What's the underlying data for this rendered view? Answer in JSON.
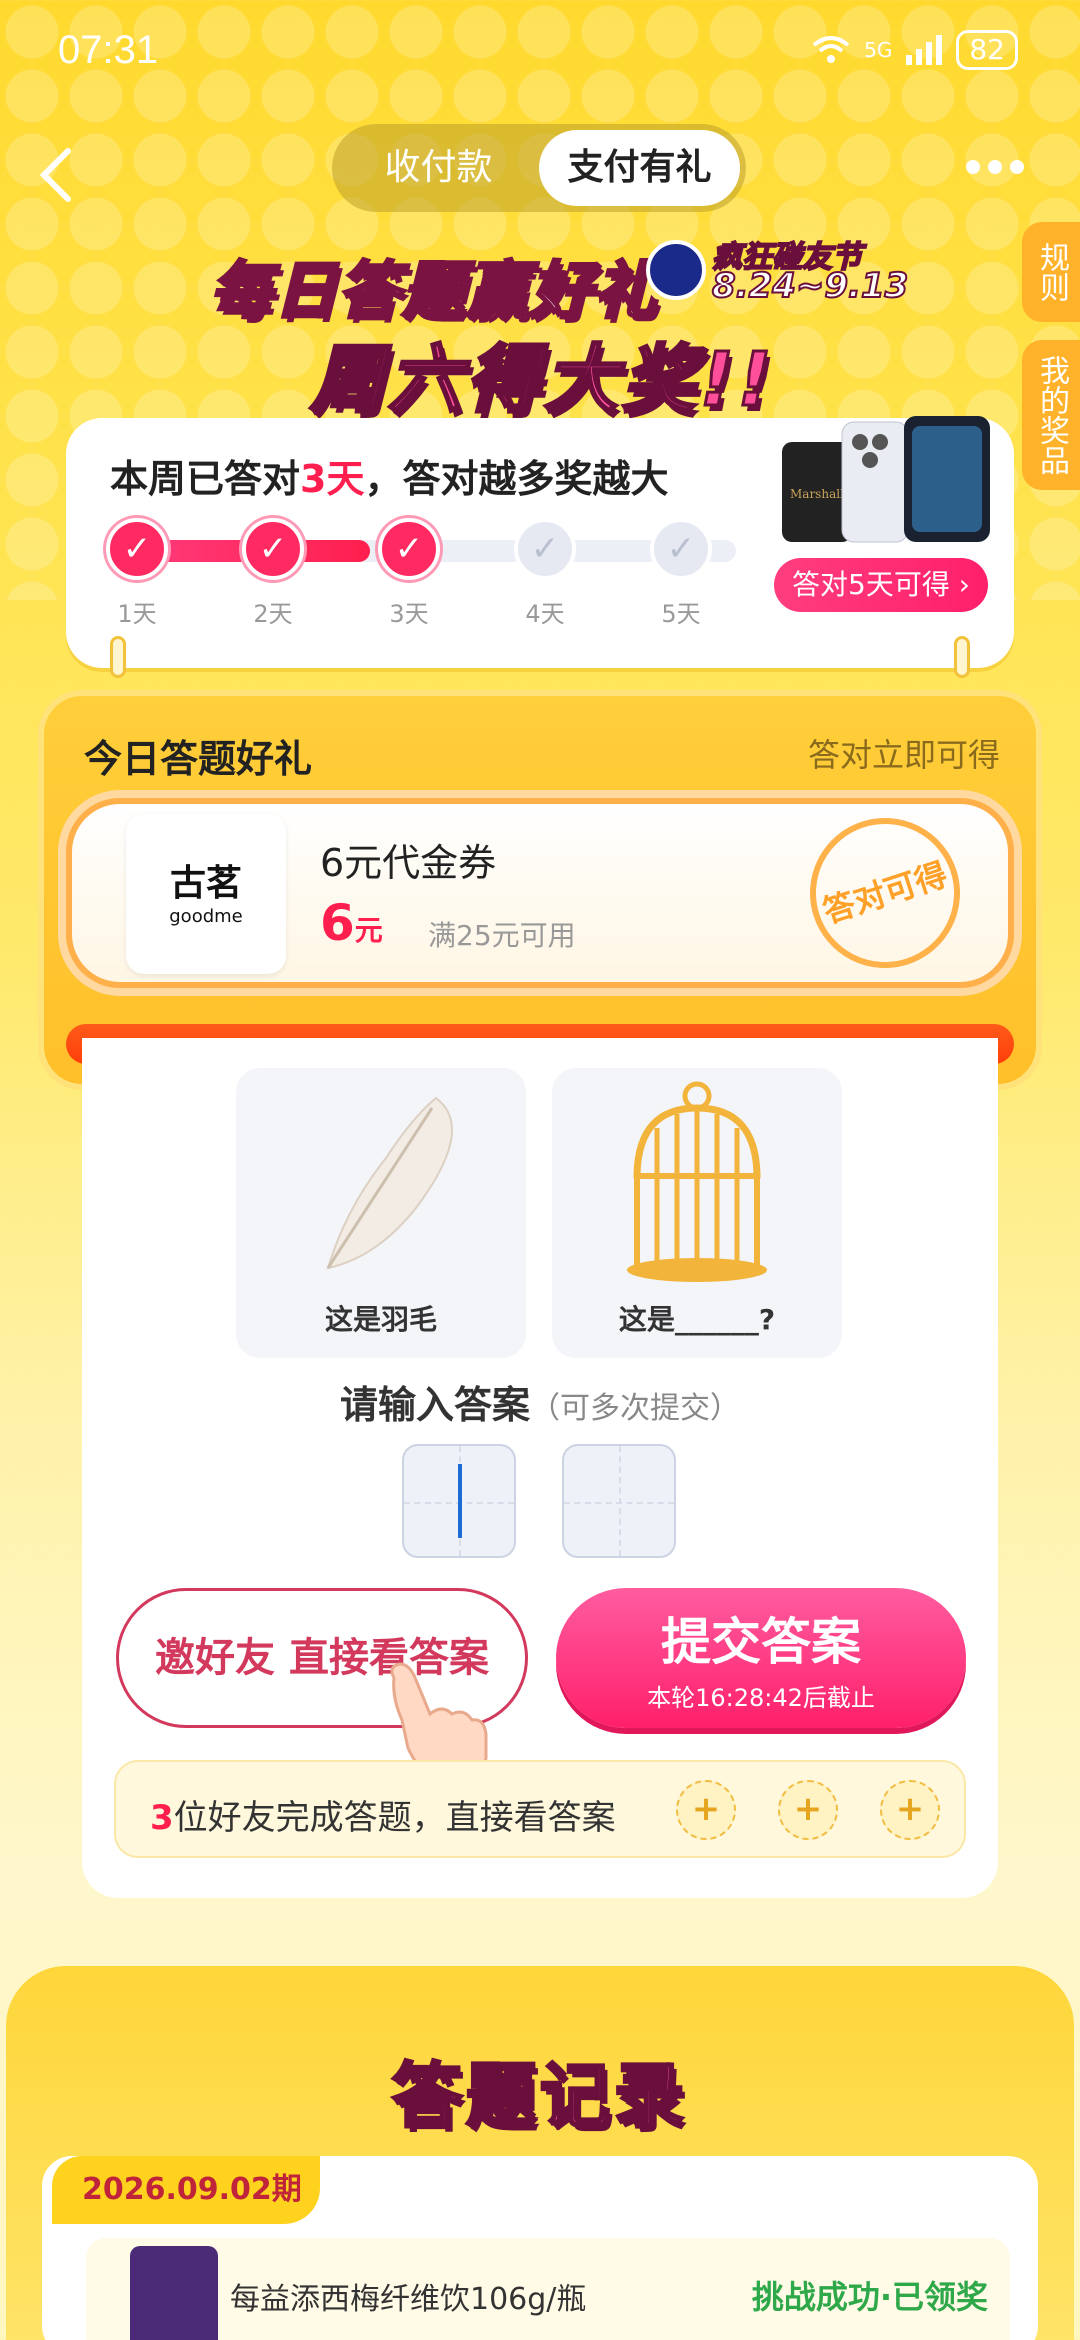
{
  "status_bar": {
    "time": "07:31",
    "network": "5G",
    "battery": "82"
  },
  "nav": {
    "tabs": [
      {
        "label": "收付款",
        "active": false
      },
      {
        "label": "支付有礼",
        "active": true
      }
    ]
  },
  "side_tabs": {
    "rules": "规则",
    "my_prizes": "我的奖品"
  },
  "banner": {
    "line1": "每日答题赢好礼",
    "line2": "周六得大奖!!",
    "festival": "疯狂碰友节",
    "dates": "8.24~9.13"
  },
  "progress": {
    "title_prefix": "本周已答对",
    "title_days": "3天",
    "title_suffix": "，答对越多奖越大",
    "completed_days": 3,
    "total_days": 5,
    "days": [
      "1天",
      "2天",
      "3天",
      "4天",
      "5天"
    ],
    "prize_button": "答对5天可得 ›"
  },
  "today_gift": {
    "heading": "今日答题好礼",
    "hint": "答对立即可得",
    "coupon": {
      "brand_cn": "古茗",
      "brand_en": "goodme",
      "name": "6元代金券",
      "amount": "6",
      "unit": "元",
      "condition": "满25元可用",
      "stamp": "答对可得"
    }
  },
  "quiz": {
    "pic1_caption": "这是羽毛",
    "pic2_caption": "这是______?",
    "prompt": "请输入答案",
    "prompt_sub": "（可多次提交）",
    "invite_button": "邀好友 直接看答案",
    "submit_button": "提交答案",
    "deadline": "本轮16:28:42后截止",
    "friends_count": "3",
    "friends_text": "位好友完成答题，直接看答案"
  },
  "records": {
    "title": "答题记录",
    "period": "2026.09.02期",
    "items": [
      {
        "name": "每益添西梅纤维饮106g/瓶",
        "status": "挑战成功·已领奖"
      }
    ]
  },
  "colors": {
    "accent": "#ff1f4e",
    "brand_yellow": "#ffd92e",
    "success": "#2fa84a"
  }
}
